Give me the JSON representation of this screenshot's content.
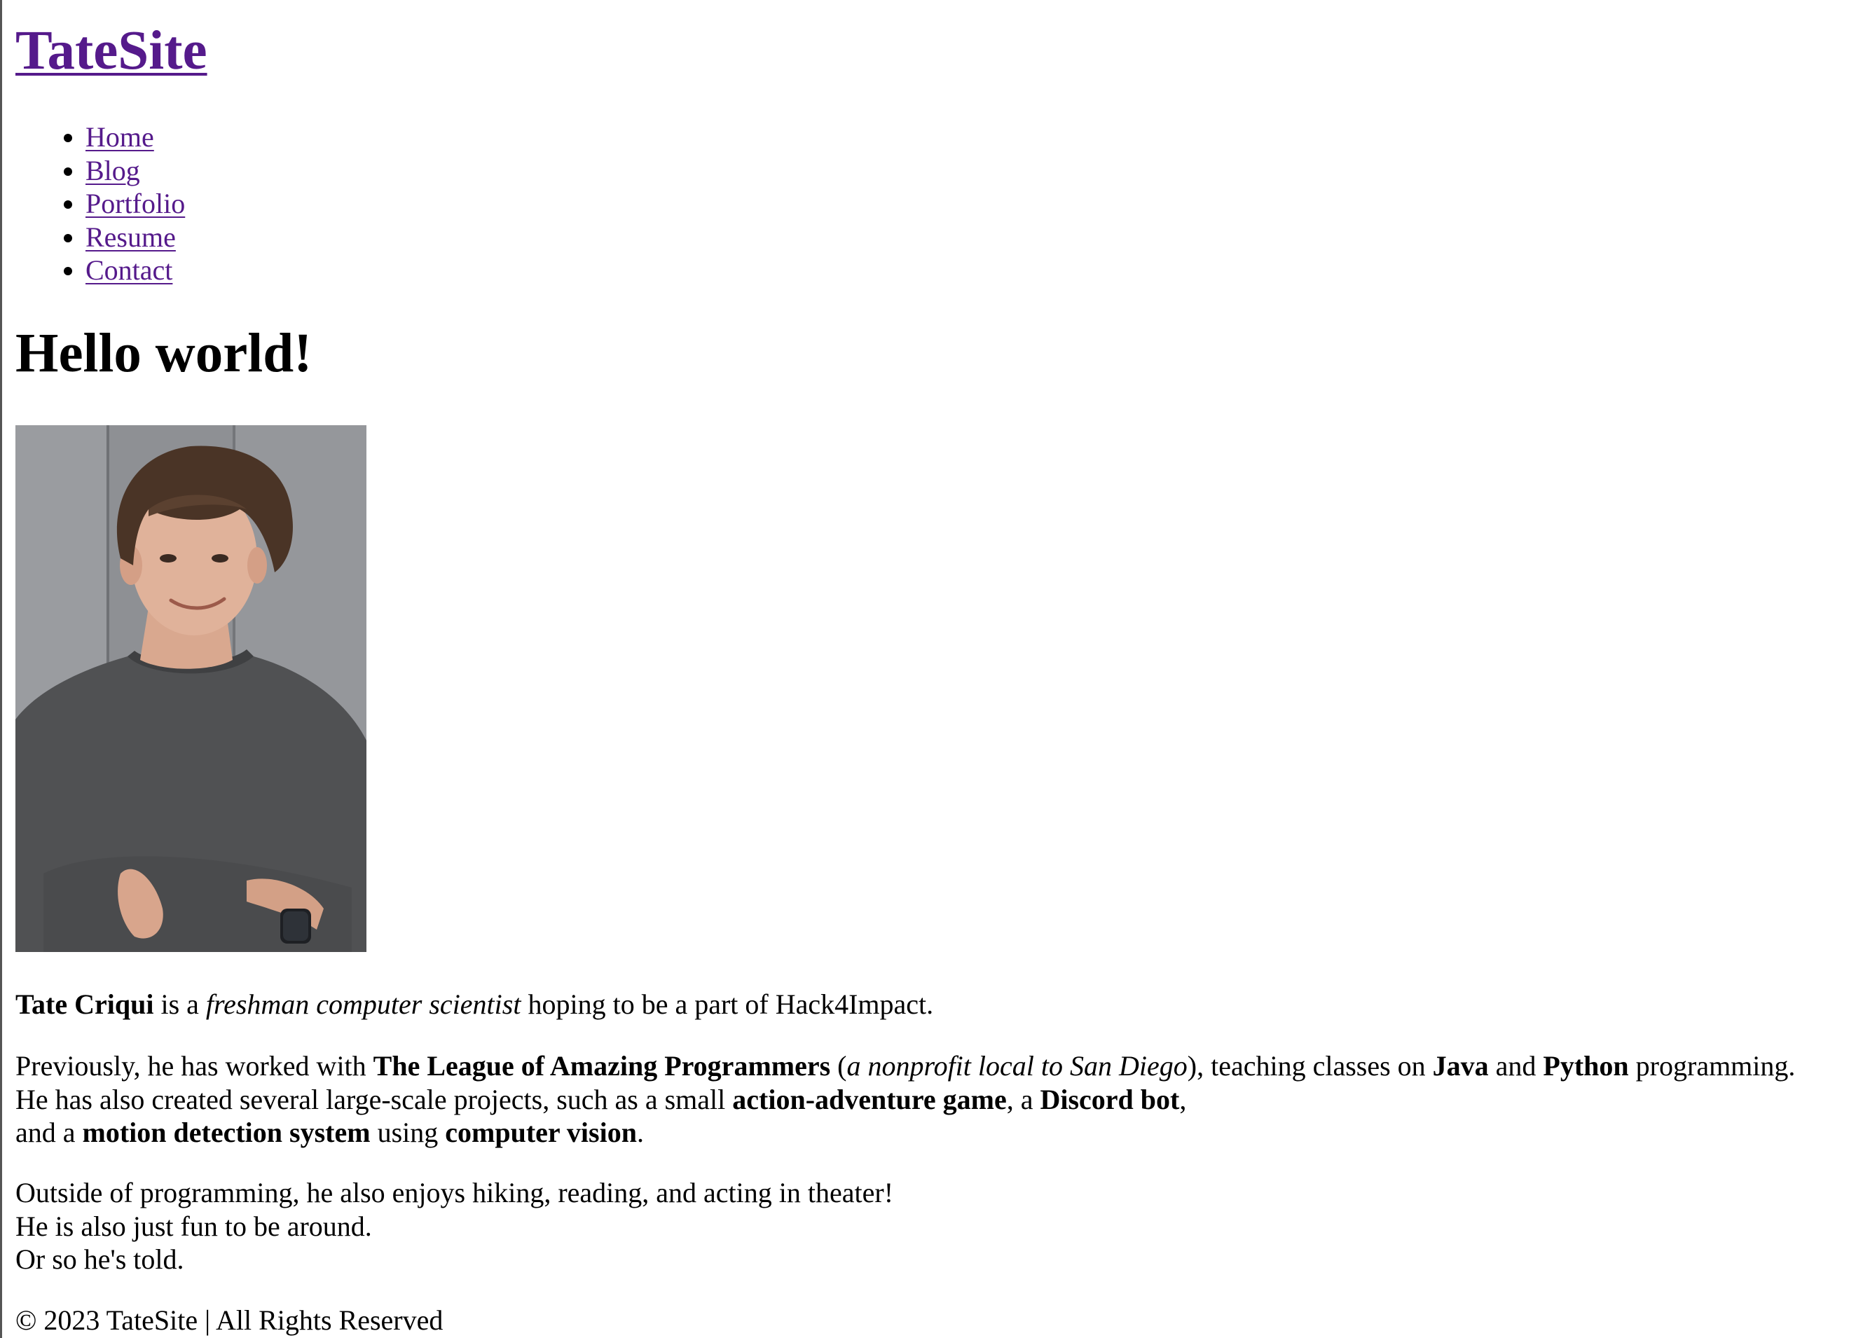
{
  "site": {
    "title": "TateSite"
  },
  "nav": {
    "items": [
      {
        "label": "Home"
      },
      {
        "label": "Blog"
      },
      {
        "label": "Portfolio"
      },
      {
        "label": "Resume"
      },
      {
        "label": "Contact"
      }
    ]
  },
  "main": {
    "heading": "Hello world!",
    "photo_description": "portrait-photo",
    "intro": {
      "name": "Tate Criqui",
      "is_a": " is a ",
      "role": "freshman computer scientist",
      "rest": " hoping to be a part of Hack4Impact."
    },
    "experience": {
      "t1": "Previously, he has worked with ",
      "org": "The League of Amazing Programmers",
      "t2": " (",
      "org_note": "a nonprofit local to San Diego",
      "t3": "), teaching classes on ",
      "lang1": "Java",
      "t4": " and ",
      "lang2": "Python",
      "t5": " programming.",
      "t6": "He has also created several large-scale projects, such as a small ",
      "proj1": "action-adventure game",
      "t7": ", a ",
      "proj2": "Discord bot",
      "t8": ",",
      "t9": "and a ",
      "proj3": "motion detection system",
      "t10": " using ",
      "tech": "computer vision",
      "t11": "."
    },
    "hobbies": {
      "line1": "Outside of programming, he also enjoys hiking, reading, and acting in theater!",
      "line2": "He is also just fun to be around.",
      "line3": "Or so he's told."
    }
  },
  "footer": {
    "text": "© 2023 TateSite | All Rights Reserved"
  }
}
